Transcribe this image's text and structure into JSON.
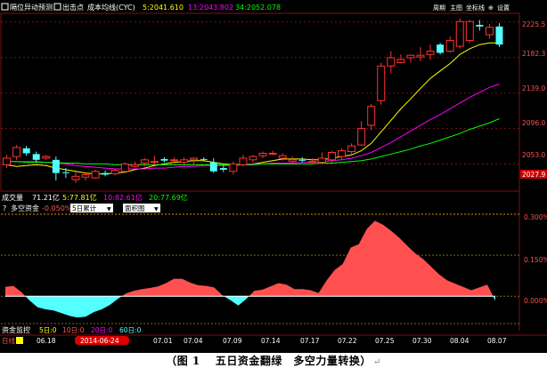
{
  "header": {
    "check1": "隔位异动预测",
    "check2": "出击点",
    "cyc_label": "成本均线(CYC)",
    "cyc5": "5:2041.610",
    "cyc13": "13:2043.802",
    "cyc34": "34:2052.078",
    "right_menu": [
      "周期",
      "主图",
      "坐标线",
      "设置"
    ]
  },
  "volume_bar": {
    "label": "成交量",
    "total": "71.21亿",
    "ma5": "5:77.81亿",
    "ma10": "10:82.61亿",
    "ma20": "20:77.69亿"
  },
  "indicator_bar": {
    "title": "多空资金",
    "value": "-0.050%",
    "select1": "5日累计",
    "select2": "面积图"
  },
  "bottom_bar": {
    "label": "资金监控",
    "period_label": "日线",
    "tabs": [
      "5日:0",
      "10日:0",
      "20日:0",
      "60日:0"
    ],
    "dates": [
      "06.18",
      "2014-06-24",
      "07.01",
      "07.04",
      "07.09",
      "07.14",
      "07.17",
      "07.22",
      "07.25",
      "07.30",
      "08.04",
      "08.07"
    ]
  },
  "caption": {
    "text": "（图 1　 五日资金翻绿　多空力量转换）",
    "mark": "↵"
  },
  "colors": {
    "bg": "#000000",
    "up": "#ff3232",
    "down": "#54ffff",
    "ma5": "#ffff00",
    "ma13": "#ff00ff",
    "ma34": "#00ff00",
    "fill_pos": "#ff5050",
    "fill_neg": "#54ffff"
  },
  "chart_data": [
    {
      "type": "candlestick",
      "title": "成本均线(CYC)",
      "y_axis_ticks": [
        "2225.5",
        "2182.3",
        "2139.0",
        "2096.0",
        "2053.0",
        "2027.9"
      ],
      "ylim": [
        2020,
        2236
      ],
      "candles": [
        {
          "o": 2052,
          "c": 2060,
          "h": 2064,
          "l": 2048
        },
        {
          "o": 2062,
          "c": 2073,
          "h": 2076,
          "l": 2058
        },
        {
          "o": 2072,
          "c": 2066,
          "h": 2075,
          "l": 2063
        },
        {
          "o": 2065,
          "c": 2058,
          "h": 2068,
          "l": 2055
        },
        {
          "o": 2060,
          "c": 2062,
          "h": 2064,
          "l": 2058
        },
        {
          "o": 2058,
          "c": 2042,
          "h": 2062,
          "l": 2033
        },
        {
          "o": 2043,
          "c": 2042,
          "h": 2048,
          "l": 2036
        },
        {
          "o": 2034,
          "c": 2038,
          "h": 2043,
          "l": 2030
        },
        {
          "o": 2037,
          "c": 2040,
          "h": 2042,
          "l": 2033
        },
        {
          "o": 2036,
          "c": 2044,
          "h": 2046,
          "l": 2035
        },
        {
          "o": 2042,
          "c": 2040,
          "h": 2045,
          "l": 2038
        },
        {
          "o": 2041,
          "c": 2045,
          "h": 2047,
          "l": 2039
        },
        {
          "o": 2044,
          "c": 2053,
          "h": 2055,
          "l": 2042
        },
        {
          "o": 2050,
          "c": 2052,
          "h": 2056,
          "l": 2049
        },
        {
          "o": 2054,
          "c": 2058,
          "h": 2060,
          "l": 2050
        },
        {
          "o": 2055,
          "c": 2056,
          "h": 2063,
          "l": 2052
        },
        {
          "o": 2059,
          "c": 2057,
          "h": 2061,
          "l": 2055
        },
        {
          "o": 2057,
          "c": 2058,
          "h": 2061,
          "l": 2055
        },
        {
          "o": 2055,
          "c": 2058,
          "h": 2061,
          "l": 2053
        },
        {
          "o": 2058,
          "c": 2060,
          "h": 2061,
          "l": 2053
        },
        {
          "o": 2059,
          "c": 2058,
          "h": 2061,
          "l": 2056
        },
        {
          "o": 2055,
          "c": 2044,
          "h": 2060,
          "l": 2042
        },
        {
          "o": 2048,
          "c": 2046,
          "h": 2051,
          "l": 2043
        },
        {
          "o": 2044,
          "c": 2053,
          "h": 2056,
          "l": 2040
        },
        {
          "o": 2052,
          "c": 2060,
          "h": 2064,
          "l": 2050
        },
        {
          "o": 2058,
          "c": 2062,
          "h": 2064,
          "l": 2055
        },
        {
          "o": 2063,
          "c": 2066,
          "h": 2068,
          "l": 2060
        },
        {
          "o": 2066,
          "c": 2066,
          "h": 2069,
          "l": 2064
        },
        {
          "o": 2060,
          "c": 2063,
          "h": 2066,
          "l": 2057
        },
        {
          "o": 2056,
          "c": 2058,
          "h": 2062,
          "l": 2052
        },
        {
          "o": 2058,
          "c": 2057,
          "h": 2061,
          "l": 2055
        },
        {
          "o": 2056,
          "c": 2056,
          "h": 2060,
          "l": 2053
        },
        {
          "o": 2055,
          "c": 2060,
          "h": 2067,
          "l": 2055
        },
        {
          "o": 2058,
          "c": 2067,
          "h": 2069,
          "l": 2053
        },
        {
          "o": 2062,
          "c": 2069,
          "h": 2072,
          "l": 2058
        },
        {
          "o": 2068,
          "c": 2075,
          "h": 2078,
          "l": 2064
        },
        {
          "o": 2076,
          "c": 2096,
          "h": 2105,
          "l": 2075
        },
        {
          "o": 2100,
          "c": 2123,
          "h": 2126,
          "l": 2094
        },
        {
          "o": 2130,
          "c": 2172,
          "h": 2176,
          "l": 2125
        },
        {
          "o": 2172,
          "c": 2182,
          "h": 2190,
          "l": 2163
        },
        {
          "o": 2176,
          "c": 2180,
          "h": 2186,
          "l": 2175
        },
        {
          "o": 2182,
          "c": 2185,
          "h": 2186,
          "l": 2176
        },
        {
          "o": 2183,
          "c": 2185,
          "h": 2195,
          "l": 2178
        },
        {
          "o": 2186,
          "c": 2190,
          "h": 2198,
          "l": 2180
        },
        {
          "o": 2198,
          "c": 2188,
          "h": 2200,
          "l": 2186
        },
        {
          "o": 2190,
          "c": 2203,
          "h": 2208,
          "l": 2188
        },
        {
          "o": 2196,
          "c": 2226,
          "h": 2230,
          "l": 2193
        },
        {
          "o": 2203,
          "c": 2226,
          "h": 2228,
          "l": 2200
        },
        {
          "o": 2222,
          "c": 2220,
          "h": 2228,
          "l": 2215
        },
        {
          "o": 2210,
          "c": 2219,
          "h": 2223,
          "l": 2205
        },
        {
          "o": 2220,
          "c": 2198,
          "h": 2224,
          "l": 2195
        }
      ],
      "series": [
        {
          "values": [
            2052,
            2050,
            2051,
            2052,
            2051,
            2048,
            2046,
            2044,
            2042,
            2041,
            2041,
            2042,
            2043,
            2046,
            2048,
            2051,
            2053,
            2055,
            2056,
            2057,
            2057,
            2055,
            2053,
            2052,
            2052,
            2053,
            2055,
            2057,
            2059,
            2059,
            2059,
            2058,
            2058,
            2060,
            2062,
            2064,
            2069,
            2078,
            2092,
            2106,
            2120,
            2132,
            2145,
            2157,
            2166,
            2175,
            2186,
            2193,
            2198,
            2200,
            2200
          ]
        },
        {
          "values": [
            2056,
            2056,
            2056,
            2056,
            2055,
            2054,
            2053,
            2051,
            2050,
            2049,
            2048,
            2047,
            2047,
            2047,
            2047,
            2048,
            2048,
            2049,
            2050,
            2050,
            2051,
            2051,
            2051,
            2051,
            2052,
            2053,
            2053,
            2054,
            2054,
            2054,
            2055,
            2055,
            2056,
            2057,
            2058,
            2060,
            2063,
            2067,
            2073,
            2079,
            2086,
            2093,
            2100,
            2107,
            2113,
            2120,
            2127,
            2134,
            2140,
            2146,
            2150
          ]
        },
        {
          "values": [
            2056,
            2056,
            2055,
            2055,
            2055,
            2055,
            2054,
            2054,
            2053,
            2053,
            2053,
            2052,
            2052,
            2052,
            2052,
            2052,
            2052,
            2052,
            2052,
            2052,
            2052,
            2052,
            2052,
            2052,
            2052,
            2052,
            2053,
            2053,
            2053,
            2053,
            2053,
            2053,
            2054,
            2054,
            2055,
            2056,
            2057,
            2059,
            2062,
            2065,
            2068,
            2071,
            2075,
            2078,
            2082,
            2086,
            2090,
            2095,
            2099,
            2103,
            2108
          ]
        }
      ]
    },
    {
      "type": "area",
      "title": "多空资金",
      "y_axis_ticks": [
        "0.300%",
        "0.150%",
        "0.000%"
      ],
      "ylim": [
        -0.1,
        0.3
      ],
      "values": [
        0.034,
        0.038,
        0.015,
        -0.015,
        -0.04,
        -0.048,
        -0.052,
        -0.062,
        -0.072,
        -0.078,
        -0.075,
        -0.058,
        -0.048,
        -0.032,
        -0.01,
        0.01,
        0.02,
        0.026,
        0.03,
        0.036,
        0.048,
        0.064,
        0.064,
        0.05,
        0.04,
        0.038,
        0.032,
        0.004,
        -0.014,
        -0.034,
        -0.01,
        0.02,
        0.024,
        0.036,
        0.048,
        0.042,
        0.026,
        0.026,
        0.022,
        0.012,
        0.058,
        0.096,
        0.118,
        0.178,
        0.19,
        0.246,
        0.276,
        0.262,
        0.24,
        0.215,
        0.186,
        0.158,
        0.136,
        0.108,
        0.08,
        0.058,
        0.046,
        0.034,
        0.022,
        0.032,
        0.042,
        -0.016
      ]
    }
  ]
}
